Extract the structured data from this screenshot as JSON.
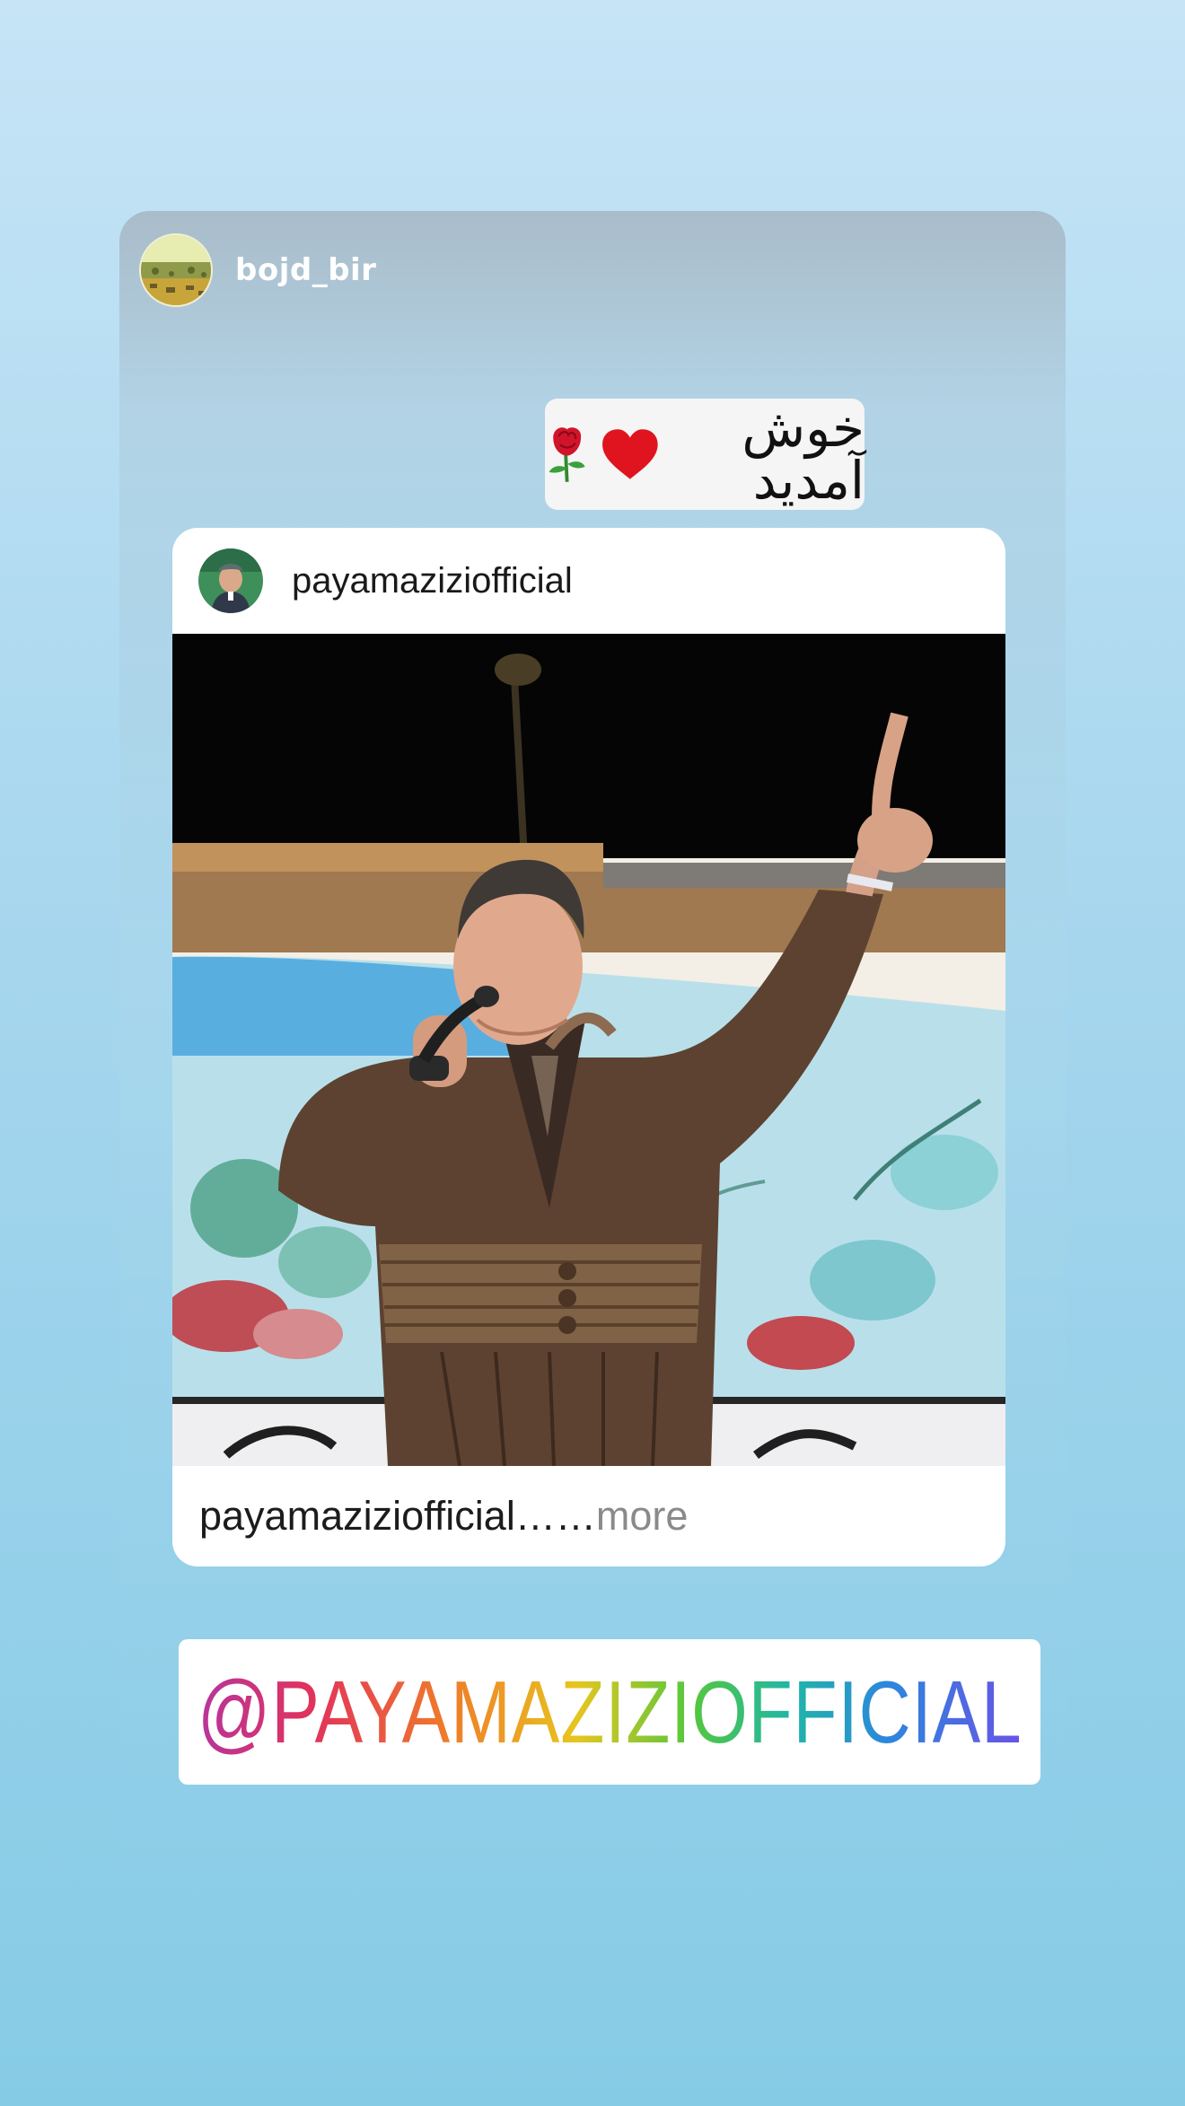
{
  "story": {
    "username": "bojd_bir",
    "avatar_icon": "landscape-avatar-icon"
  },
  "welcome_sticker": {
    "text": "خوش آمدید",
    "icons": [
      "red-heart-icon",
      "rose-icon"
    ]
  },
  "shared_post": {
    "username": "payamaziziofficial",
    "avatar_icon": "profile-avatar-icon",
    "image_icon": "singer-performing-photo",
    "caption_user": "payamaziziofficial",
    "caption_text": " ……",
    "caption_more": " more"
  },
  "mention_sticker": {
    "text": "@PAYAMAZIZIOFFICIAL"
  },
  "colors": {
    "background_top": "#c6e4f6",
    "background_bottom": "#86cbe5",
    "mention_gradient": [
      "#b7359c",
      "#e2325b",
      "#ef7a2a",
      "#e7c51e",
      "#54c73e",
      "#1fb5a8",
      "#2d86dd",
      "#6a52e6"
    ]
  }
}
